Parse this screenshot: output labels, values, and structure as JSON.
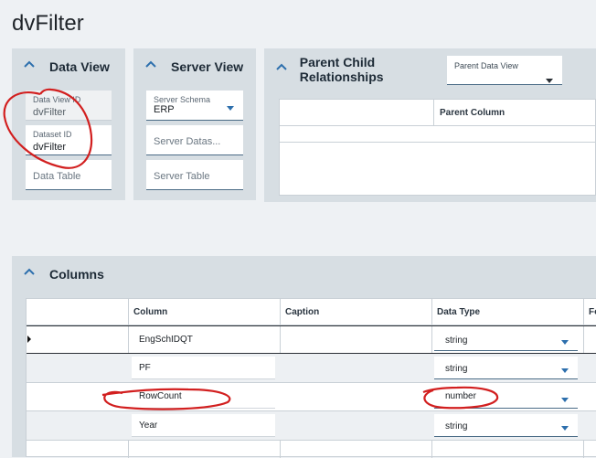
{
  "page": {
    "title": "dvFilter"
  },
  "data_view_panel": {
    "title": "Data View",
    "data_view_id": {
      "label": "Data View ID",
      "value": "dvFilter"
    },
    "dataset_id": {
      "label": "Dataset ID",
      "value": "dvFilter"
    },
    "data_table": {
      "placeholder": "Data Table"
    }
  },
  "server_view_panel": {
    "title": "Server View",
    "server_schema": {
      "label": "Server Schema",
      "value": "ERP"
    },
    "server_dataset": {
      "placeholder": "Server Datas..."
    },
    "server_table": {
      "placeholder": "Server Table"
    }
  },
  "relationships_panel": {
    "title": "Parent Child Relationships",
    "parent_data_view": {
      "label": "Parent Data View"
    },
    "columns": [
      "Parent Column"
    ]
  },
  "columns_panel": {
    "title": "Columns",
    "headers": [
      "Column",
      "Caption",
      "Data Type",
      "Fo"
    ],
    "rows": [
      {
        "column": "EngSchIDQT",
        "caption": "",
        "data_type": "string"
      },
      {
        "column": "PF",
        "caption": "",
        "data_type": "string"
      },
      {
        "column": "RowCount",
        "caption": "",
        "data_type": "number"
      },
      {
        "column": "Year",
        "caption": "",
        "data_type": "string"
      }
    ]
  },
  "colors": {
    "accent": "#2d6fad",
    "panel": "#d7dee3",
    "annotation": "#d21f1f"
  }
}
